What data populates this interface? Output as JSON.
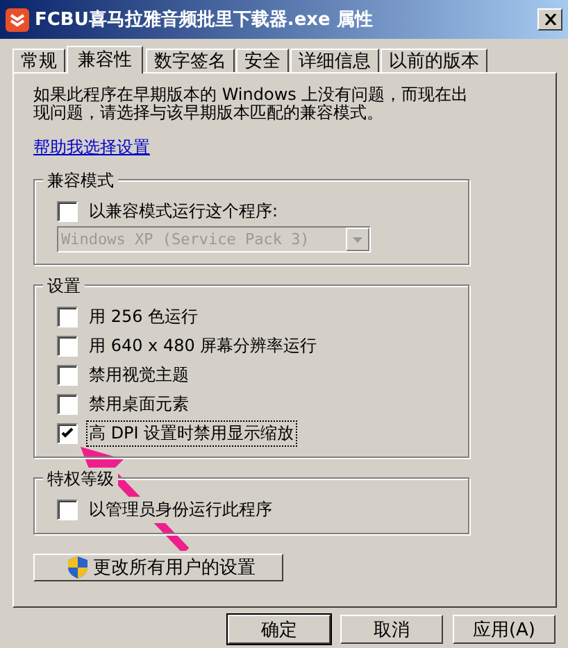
{
  "window": {
    "title": "FCBU喜马拉雅音频批里下载器.exe 属性"
  },
  "tabs": [
    {
      "label": "常规",
      "selected": false
    },
    {
      "label": "兼容性",
      "selected": true
    },
    {
      "label": "数字签名",
      "selected": false
    },
    {
      "label": "安全",
      "selected": false
    },
    {
      "label": "详细信息",
      "selected": false
    },
    {
      "label": "以前的版本",
      "selected": false
    }
  ],
  "intro": "如果此程序在早期版本的 Windows 上没有问题，而现在出现问题，请选择与该早期版本匹配的兼容模式。",
  "help_link": "帮助我选择设置",
  "compat_mode": {
    "title": "兼容模式",
    "checkbox": {
      "label": "以兼容模式运行这个程序:",
      "checked": false
    },
    "dropdown": {
      "value": "Windows XP (Service Pack 3)",
      "disabled": true
    }
  },
  "settings": {
    "title": "设置",
    "options": [
      {
        "label": "用 256 色运行",
        "checked": false,
        "focused": false
      },
      {
        "label": "用 640 x 480 屏幕分辨率运行",
        "checked": false,
        "focused": false
      },
      {
        "label": "禁用视觉主题",
        "checked": false,
        "focused": false
      },
      {
        "label": "禁用桌面元素",
        "checked": false,
        "focused": false
      },
      {
        "label": "高 DPI 设置时禁用显示缩放",
        "checked": true,
        "focused": true
      }
    ]
  },
  "privilege": {
    "title": "特权等级",
    "checkbox": {
      "label": "以管理员身份运行此程序",
      "checked": false
    }
  },
  "all_users_button": "更改所有用户的设置",
  "buttons": [
    {
      "label": "确定",
      "default": true
    },
    {
      "label": "取消",
      "default": false
    },
    {
      "label": "应用(A)",
      "default": false
    }
  ]
}
